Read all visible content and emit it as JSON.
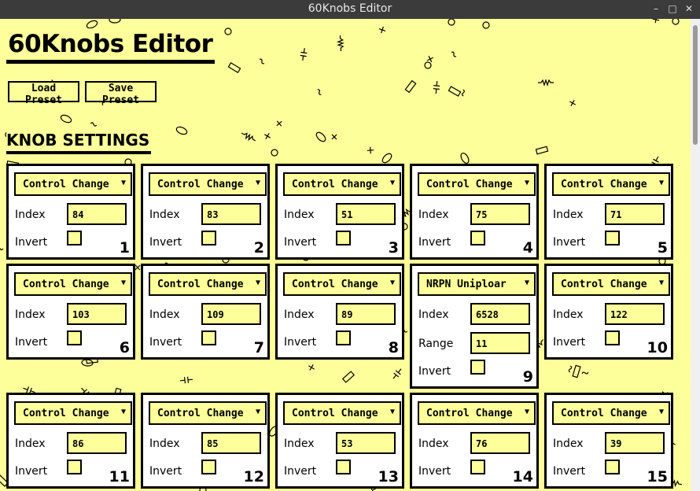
{
  "window": {
    "title": "60Knobs Editor"
  },
  "app": {
    "title": "60Knobs Editor",
    "load_preset": "Load Preset",
    "save_preset": "Save Preset",
    "section_title": "KNOB SETTINGS"
  },
  "labels": {
    "index": "Index",
    "invert": "Invert",
    "range": "Range"
  },
  "colors": {
    "background": "#fcff9a",
    "accent": "#000000",
    "panel": "#ffffff"
  },
  "knobs": [
    {
      "number": "1",
      "type": "Control Change",
      "index": "84",
      "range": null,
      "invert": false
    },
    {
      "number": "2",
      "type": "Control Change",
      "index": "83",
      "range": null,
      "invert": false
    },
    {
      "number": "3",
      "type": "Control Change",
      "index": "51",
      "range": null,
      "invert": false
    },
    {
      "number": "4",
      "type": "Control Change",
      "index": "75",
      "range": null,
      "invert": false
    },
    {
      "number": "5",
      "type": "Control Change",
      "index": "71",
      "range": null,
      "invert": false
    },
    {
      "number": "6",
      "type": "Control Change",
      "index": "103",
      "range": null,
      "invert": false
    },
    {
      "number": "7",
      "type": "Control Change",
      "index": "109",
      "range": null,
      "invert": false
    },
    {
      "number": "8",
      "type": "Control Change",
      "index": "89",
      "range": null,
      "invert": false
    },
    {
      "number": "9",
      "type": "NRPN Uniploar",
      "index": "6528",
      "range": "11",
      "invert": false
    },
    {
      "number": "10",
      "type": "Control Change",
      "index": "122",
      "range": null,
      "invert": false
    },
    {
      "number": "11",
      "type": "Control Change",
      "index": "86",
      "range": null,
      "invert": false
    },
    {
      "number": "12",
      "type": "Control Change",
      "index": "85",
      "range": null,
      "invert": false
    },
    {
      "number": "13",
      "type": "Control Change",
      "index": "53",
      "range": null,
      "invert": false
    },
    {
      "number": "14",
      "type": "Control Change",
      "index": "76",
      "range": null,
      "invert": false
    },
    {
      "number": "15",
      "type": "Control Change",
      "index": "39",
      "range": null,
      "invert": false
    }
  ]
}
